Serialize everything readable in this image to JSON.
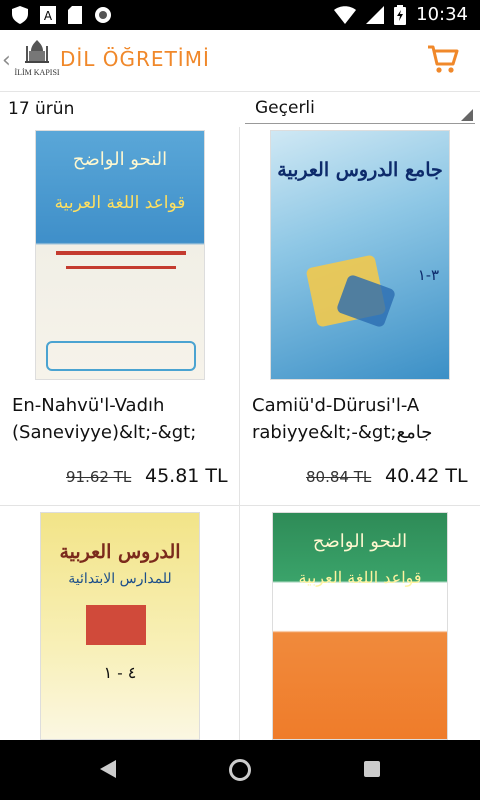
{
  "status": {
    "time": "10:34"
  },
  "header": {
    "back_icon": "chevron-left-icon",
    "logo_text": "İLİM KAPISI",
    "title": "DİL ÖĞRETİMİ",
    "cart_icon": "cart-icon",
    "accent_color": "#f0882a"
  },
  "toolbar": {
    "count": "17 ürün",
    "sort_selected": "Geçerli"
  },
  "products": [
    {
      "name_line1": "En-Nahvü'l-Vadıh",
      "name_line2": "(Saneviyye)&lt;-&gt;",
      "old_price": "91.62 TL",
      "new_price": "45.81 TL",
      "cover_title": "النحو الواضح",
      "cover_subtitle": "قواعد اللغة العربية"
    },
    {
      "name_line1": "Camiü'd-Dürusi'l-A",
      "name_line2": "rabiyye&lt;-&gt;جامع",
      "old_price": "80.84 TL",
      "new_price": "40.42 TL",
      "cover_title": "جامع الدروس العربية",
      "cover_subtitle": "٣-١"
    },
    {
      "cover_title": "الدروس العربية",
      "cover_subtitle": "للمدارس الابتدائية",
      "cover_number": "٤ - ١"
    },
    {
      "cover_title": "النحو الواضح",
      "cover_subtitle": "قواعد اللغة العربية"
    }
  ]
}
